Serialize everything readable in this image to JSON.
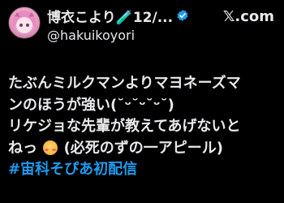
{
  "header": {
    "display_name": "博衣こより🧪12/...",
    "handle": "@hakuikoyori",
    "brand_label": "𝕏.com"
  },
  "icons": {
    "avatar": "avatar-image",
    "verified": "verified-badge-icon",
    "brand": "x-logo-icon",
    "emoji": "smiling-face-with-hearts-icon"
  },
  "tweet": {
    "line1": "たぶんミルクマンよりマヨネーズマ",
    "line2": "ンのほうが強い(˘ᵕ˘ᵕ˘ᵕ˘)",
    "line3": "リケジョな先輩が教えてあげないと",
    "line4_before_emoji": "ねっ",
    "line4_after_emoji": "(必死のずの一アピール)",
    "hashtag": "#宙科そぴあ初配信"
  },
  "colors": {
    "background": "#000000",
    "text": "#e7e9ea",
    "hashtag": "#1d9bf0",
    "verified": "#1d9bf0"
  }
}
